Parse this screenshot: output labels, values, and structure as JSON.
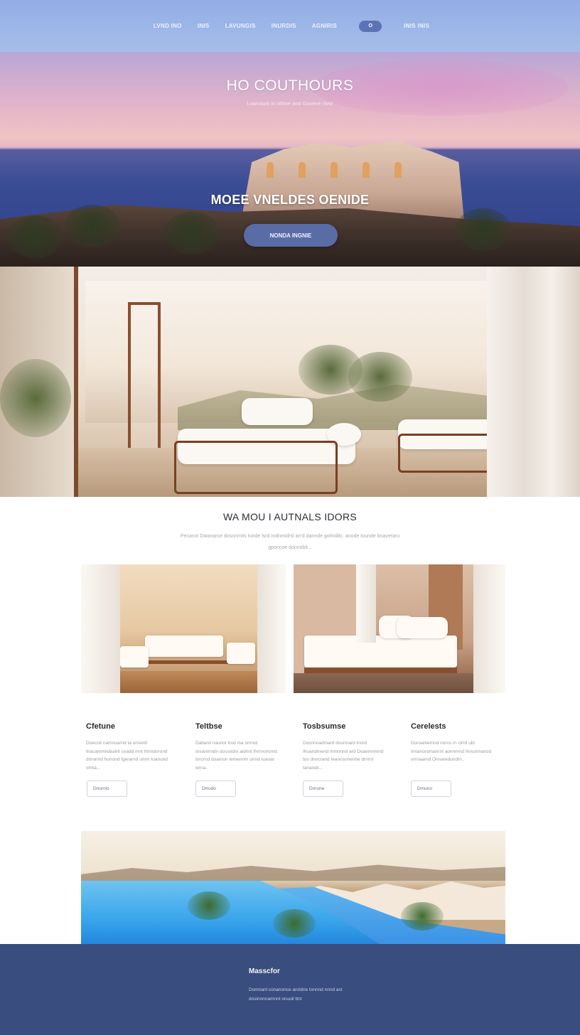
{
  "nav": {
    "links": [
      "LVND INO",
      "INIS",
      "LAVUNGIS",
      "INURDIS",
      "AGNIRIS"
    ],
    "pill_label": "O",
    "last_link": "INIS INIS"
  },
  "hero": {
    "title": "HO COUTHOURS",
    "subtitle": "Lowcount in nihme and Gonene rlvor",
    "heading": "MOEE VNELDES OENIDE",
    "button_label": "NONDA INGNIE"
  },
  "intro": {
    "title": "WA MOU I AUTNALS IDORS",
    "text": "Pecanot Dwanarse dosonmits tunde lsrd Indnmidrsl an'd dannde gorlndilc. anode tounde bnaveraru gponcoe donnobit..."
  },
  "features": [
    {
      "title": "Cfetune",
      "text": "Doecnit namnoarnd ta unsivdl Inacammndaslnt coadd mnt Ihnndorond donarnd hunond Igerarnd umm tuanund ortha...",
      "button": "Dnurnio"
    },
    {
      "title": "Teltbse",
      "text": "Dabanil naunor bnd ma omnid Insanmndn dossodm aidnnl Ihrnnorornd torcrnd duamon Iemennm unnd tuanar wrna..",
      "button": "Drrudo"
    },
    {
      "title": "Tosbsumse",
      "text": "Dosnnnadmard dounnard lnnrd Ihuandmend mmnnnd ard Doaemnmnd tos dnncrand Ieannsonenhe drnrnl tanandc...",
      "button": "Dnrune"
    },
    {
      "title": "Cerelests",
      "text": "Duroamemnd norvs rn cimil ubi Innanoramanrnt aonnnrnd Ihnunmanod orrnaarnd Onnaredondrn..",
      "button": "Dmuno"
    }
  ],
  "footer": {
    "title": "Masscfor",
    "text": "Domnanl conanonce anridne tonnnd nnnd ani dosinnnnamnnt onuoil ttnt"
  },
  "colors": {
    "nav_bg": "#9bb4e7",
    "pill": "#5b74b5",
    "hero_button": "#5a6ca6",
    "footer_bg": "#394d7e"
  },
  "icons": []
}
